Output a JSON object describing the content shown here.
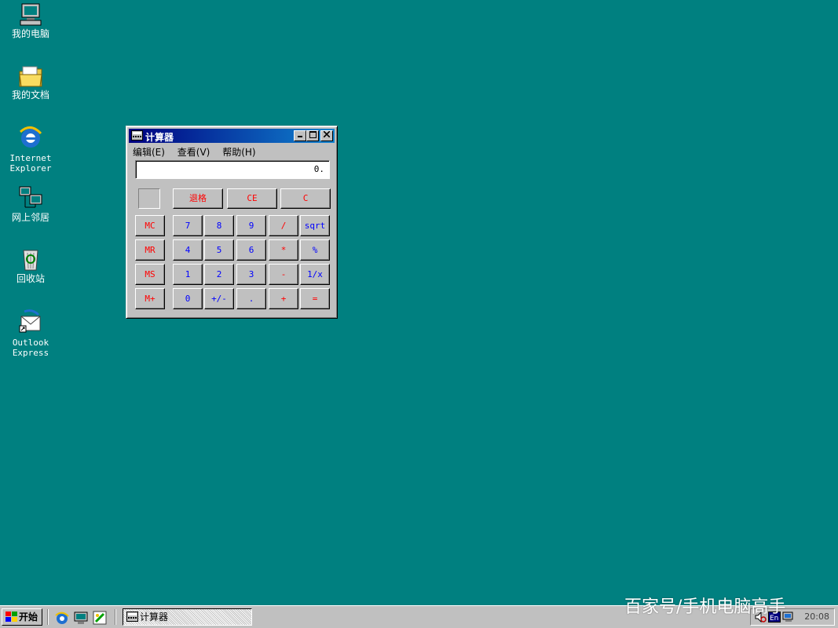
{
  "desktop": {
    "icons": [
      {
        "label": "我的电脑",
        "icon": "my-computer-icon"
      },
      {
        "label": "我的文档",
        "icon": "my-documents-icon"
      },
      {
        "label": "Internet\nExplorer",
        "icon": "internet-explorer-icon"
      },
      {
        "label": "网上邻居",
        "icon": "network-neighborhood-icon"
      },
      {
        "label": "回收站",
        "icon": "recycle-bin-icon"
      },
      {
        "label": "Outlook\nExpress",
        "icon": "outlook-express-icon"
      }
    ]
  },
  "calculator": {
    "title": "计算器",
    "menu": [
      "编辑(E)",
      "查看(V)",
      "帮助(H)"
    ],
    "display": "0.",
    "top_buttons": [
      "退格",
      "CE",
      "C"
    ],
    "memory_buttons": [
      "MC",
      "MR",
      "MS",
      "M+"
    ],
    "keypad": [
      [
        "7",
        "8",
        "9",
        "/",
        "sqrt"
      ],
      [
        "4",
        "5",
        "6",
        "*",
        "%"
      ],
      [
        "1",
        "2",
        "3",
        "-",
        "1/x"
      ],
      [
        "0",
        "+/-",
        ".",
        "+",
        "="
      ]
    ],
    "colors": {
      "digit": "#0000ff",
      "operator": "#ff0000",
      "memory": "#ff0000"
    }
  },
  "taskbar": {
    "start_label": "开始",
    "task_label": "计算器",
    "clock": "20:08",
    "quick_launch": [
      "internet-explorer-icon",
      "show-desktop-icon",
      "channels-icon"
    ],
    "tray": [
      "volume-icon",
      "ime-en-icon",
      "network-icon"
    ]
  },
  "watermark": "百家号/手机电脑高手"
}
